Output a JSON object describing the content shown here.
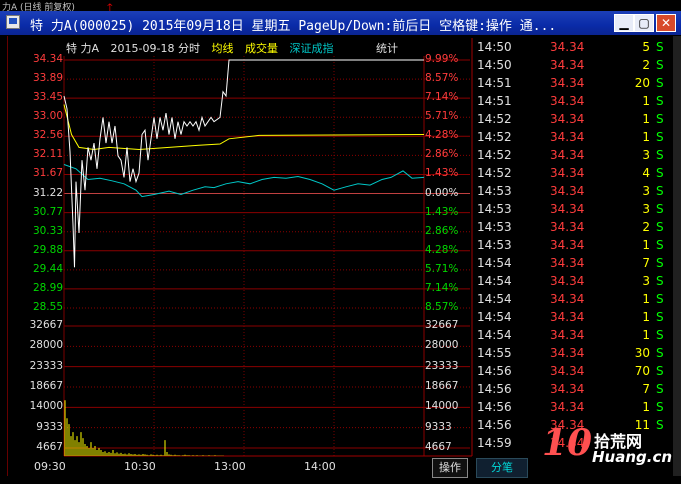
{
  "background_window": {
    "title": "力A (日线 前复权)"
  },
  "window": {
    "title": "特  力A(000025) 2015年09月18日 星期五 PageUp/Down:前后日 空格键:操作 通..."
  },
  "chart_header": {
    "prefix": "特  力A",
    "date_label": "2015-09-18 分时",
    "avg_line": "均线",
    "volume": "成交量",
    "index": "深证成指",
    "stats": "统计"
  },
  "colors": {
    "up": "#ff3c3c",
    "down": "#00d800",
    "price_line": "#ffffff",
    "avg_line": "#ffff00",
    "index_line": "#00c8c8",
    "volume": "#ffff00"
  },
  "chart_data": {
    "type": "line",
    "title": "",
    "price_axis": [
      "34.34",
      "33.89",
      "33.45",
      "33.00",
      "32.56",
      "32.11",
      "31.67",
      "31.22",
      "30.77",
      "30.33",
      "29.88",
      "29.44",
      "28.99",
      "28.55"
    ],
    "pct_axis": [
      "9.99%",
      "8.57%",
      "7.14%",
      "5.71%",
      "4.28%",
      "2.86%",
      "1.43%",
      "0.00%",
      "1.43%",
      "2.86%",
      "4.28%",
      "5.71%",
      "7.14%",
      "8.57%"
    ],
    "volume_axis": [
      "32667",
      "28000",
      "23333",
      "18667",
      "14000",
      "9333",
      "4667"
    ],
    "x_ticks": [
      "09:30",
      "10:30",
      "13:00",
      "14:00"
    ],
    "prev_close": 31.22,
    "price_series": [
      {
        "t": 0,
        "v": 33.5
      },
      {
        "t": 2,
        "v": 33.2
      },
      {
        "t": 4,
        "v": 32.2
      },
      {
        "t": 6,
        "v": 30.5
      },
      {
        "t": 7,
        "v": 29.5
      },
      {
        "t": 8,
        "v": 31.5
      },
      {
        "t": 10,
        "v": 30.3
      },
      {
        "t": 12,
        "v": 32.0
      },
      {
        "t": 14,
        "v": 31.3
      },
      {
        "t": 16,
        "v": 32.3
      },
      {
        "t": 18,
        "v": 32.0
      },
      {
        "t": 20,
        "v": 32.4
      },
      {
        "t": 22,
        "v": 31.8
      },
      {
        "t": 24,
        "v": 32.5
      },
      {
        "t": 26,
        "v": 33.0
      },
      {
        "t": 28,
        "v": 32.4
      },
      {
        "t": 30,
        "v": 32.9
      },
      {
        "t": 32,
        "v": 32.4
      },
      {
        "t": 34,
        "v": 32.8
      },
      {
        "t": 36,
        "v": 32.1
      },
      {
        "t": 38,
        "v": 32.0
      },
      {
        "t": 40,
        "v": 31.6
      },
      {
        "t": 42,
        "v": 32.3
      },
      {
        "t": 44,
        "v": 31.5
      },
      {
        "t": 46,
        "v": 31.8
      },
      {
        "t": 48,
        "v": 31.5
      },
      {
        "t": 50,
        "v": 31.7
      },
      {
        "t": 52,
        "v": 32.6
      },
      {
        "t": 54,
        "v": 32.7
      },
      {
        "t": 56,
        "v": 32.0
      },
      {
        "t": 58,
        "v": 32.5
      },
      {
        "t": 60,
        "v": 33.0
      },
      {
        "t": 62,
        "v": 32.5
      },
      {
        "t": 64,
        "v": 33.0
      },
      {
        "t": 66,
        "v": 32.7
      },
      {
        "t": 68,
        "v": 33.1
      },
      {
        "t": 70,
        "v": 32.6
      },
      {
        "t": 72,
        "v": 33.0
      },
      {
        "t": 74,
        "v": 32.5
      },
      {
        "t": 76,
        "v": 32.9
      },
      {
        "t": 78,
        "v": 32.6
      },
      {
        "t": 80,
        "v": 32.9
      },
      {
        "t": 82,
        "v": 32.8
      },
      {
        "t": 84,
        "v": 32.9
      },
      {
        "t": 86,
        "v": 32.8
      },
      {
        "t": 88,
        "v": 32.9
      },
      {
        "t": 90,
        "v": 32.7
      },
      {
        "t": 92,
        "v": 33.0
      },
      {
        "t": 94,
        "v": 32.8
      },
      {
        "t": 96,
        "v": 32.9
      },
      {
        "t": 98,
        "v": 33.0
      },
      {
        "t": 100,
        "v": 32.9
      },
      {
        "t": 104,
        "v": 33.0
      },
      {
        "t": 106,
        "v": 33.6
      },
      {
        "t": 108,
        "v": 33.5
      },
      {
        "t": 110,
        "v": 34.34
      },
      {
        "t": 240,
        "v": 34.34
      }
    ],
    "avg_series": [
      {
        "t": 0,
        "v": 33.3
      },
      {
        "t": 5,
        "v": 32.6
      },
      {
        "t": 10,
        "v": 32.3
      },
      {
        "t": 20,
        "v": 32.25
      },
      {
        "t": 30,
        "v": 32.3
      },
      {
        "t": 50,
        "v": 32.25
      },
      {
        "t": 70,
        "v": 32.3
      },
      {
        "t": 90,
        "v": 32.35
      },
      {
        "t": 104,
        "v": 32.38
      },
      {
        "t": 110,
        "v": 32.5
      },
      {
        "t": 130,
        "v": 32.58
      },
      {
        "t": 240,
        "v": 32.6
      }
    ],
    "index_series": [
      {
        "t": 0,
        "v": 31.9
      },
      {
        "t": 8,
        "v": 31.8
      },
      {
        "t": 16,
        "v": 31.55
      },
      {
        "t": 24,
        "v": 31.58
      },
      {
        "t": 32,
        "v": 31.52
      },
      {
        "t": 40,
        "v": 31.45
      },
      {
        "t": 48,
        "v": 31.3
      },
      {
        "t": 52,
        "v": 31.15
      },
      {
        "t": 60,
        "v": 31.2
      },
      {
        "t": 70,
        "v": 31.28
      },
      {
        "t": 78,
        "v": 31.2
      },
      {
        "t": 86,
        "v": 31.3
      },
      {
        "t": 94,
        "v": 31.38
      },
      {
        "t": 100,
        "v": 31.36
      },
      {
        "t": 108,
        "v": 31.45
      },
      {
        "t": 116,
        "v": 31.5
      },
      {
        "t": 124,
        "v": 31.45
      },
      {
        "t": 132,
        "v": 31.55
      },
      {
        "t": 140,
        "v": 31.6
      },
      {
        "t": 148,
        "v": 31.58
      },
      {
        "t": 156,
        "v": 31.62
      },
      {
        "t": 164,
        "v": 31.55
      },
      {
        "t": 172,
        "v": 31.45
      },
      {
        "t": 180,
        "v": 31.3
      },
      {
        "t": 188,
        "v": 31.38
      },
      {
        "t": 196,
        "v": 31.45
      },
      {
        "t": 204,
        "v": 31.42
      },
      {
        "t": 212,
        "v": 31.55
      },
      {
        "t": 218,
        "v": 31.6
      },
      {
        "t": 226,
        "v": 31.75
      },
      {
        "t": 232,
        "v": 31.58
      },
      {
        "t": 240,
        "v": 31.6
      }
    ],
    "volume_series": [
      14000,
      9500,
      8000,
      5000,
      6000,
      4000,
      5000,
      3500,
      6000,
      4500,
      3000,
      2500,
      2000,
      3500,
      2000,
      2500,
      1500,
      2000,
      1500,
      1000,
      1200,
      800,
      1000,
      800,
      1500,
      700,
      900,
      600,
      800,
      500,
      600,
      400,
      700,
      500,
      400,
      500,
      300,
      400,
      300,
      500,
      400,
      300,
      200,
      400,
      300,
      200,
      300,
      200,
      300,
      200,
      4000,
      1000,
      400,
      300,
      200,
      300,
      200,
      200,
      100,
      200,
      300,
      200,
      200,
      100,
      200,
      100,
      200,
      100,
      100,
      200,
      100,
      100,
      200,
      100,
      100,
      200,
      100,
      100,
      100,
      100
    ],
    "ylim": [
      28.55,
      34.34
    ],
    "volume_ylim": [
      0,
      32667
    ]
  },
  "time_axis": [
    "09:30",
    "10:30",
    "13:00",
    "14:00"
  ],
  "operate_button": "操作",
  "ticks_tab": "分笔",
  "ticks": [
    {
      "time": "14:50",
      "price": "34.34",
      "vol": "5",
      "dir": "S"
    },
    {
      "time": "14:50",
      "price": "34.34",
      "vol": "2",
      "dir": "S"
    },
    {
      "time": "14:51",
      "price": "34.34",
      "vol": "20",
      "dir": "S"
    },
    {
      "time": "14:51",
      "price": "34.34",
      "vol": "1",
      "dir": "S"
    },
    {
      "time": "14:52",
      "price": "34.34",
      "vol": "1",
      "dir": "S"
    },
    {
      "time": "14:52",
      "price": "34.34",
      "vol": "1",
      "dir": "S"
    },
    {
      "time": "14:52",
      "price": "34.34",
      "vol": "3",
      "dir": "S"
    },
    {
      "time": "14:52",
      "price": "34.34",
      "vol": "4",
      "dir": "S"
    },
    {
      "time": "14:53",
      "price": "34.34",
      "vol": "3",
      "dir": "S"
    },
    {
      "time": "14:53",
      "price": "34.34",
      "vol": "3",
      "dir": "S"
    },
    {
      "time": "14:53",
      "price": "34.34",
      "vol": "2",
      "dir": "S"
    },
    {
      "time": "14:53",
      "price": "34.34",
      "vol": "1",
      "dir": "S"
    },
    {
      "time": "14:54",
      "price": "34.34",
      "vol": "7",
      "dir": "S"
    },
    {
      "time": "14:54",
      "price": "34.34",
      "vol": "3",
      "dir": "S"
    },
    {
      "time": "14:54",
      "price": "34.34",
      "vol": "1",
      "dir": "S"
    },
    {
      "time": "14:54",
      "price": "34.34",
      "vol": "1",
      "dir": "S"
    },
    {
      "time": "14:54",
      "price": "34.34",
      "vol": "1",
      "dir": "S"
    },
    {
      "time": "14:55",
      "price": "34.34",
      "vol": "30",
      "dir": "S"
    },
    {
      "time": "14:56",
      "price": "34.34",
      "vol": "70",
      "dir": "S"
    },
    {
      "time": "14:56",
      "price": "34.34",
      "vol": "7",
      "dir": "S"
    },
    {
      "time": "14:56",
      "price": "34.34",
      "vol": "1",
      "dir": "S"
    },
    {
      "time": "14:56",
      "price": "34.34",
      "vol": "11",
      "dir": "S"
    },
    {
      "time": "14:59",
      "price": "34.34",
      "vol": "",
      "dir": ""
    }
  ],
  "watermark": {
    "num": "10",
    "top": "拾荒网",
    "bottom": "Huang.cn"
  }
}
